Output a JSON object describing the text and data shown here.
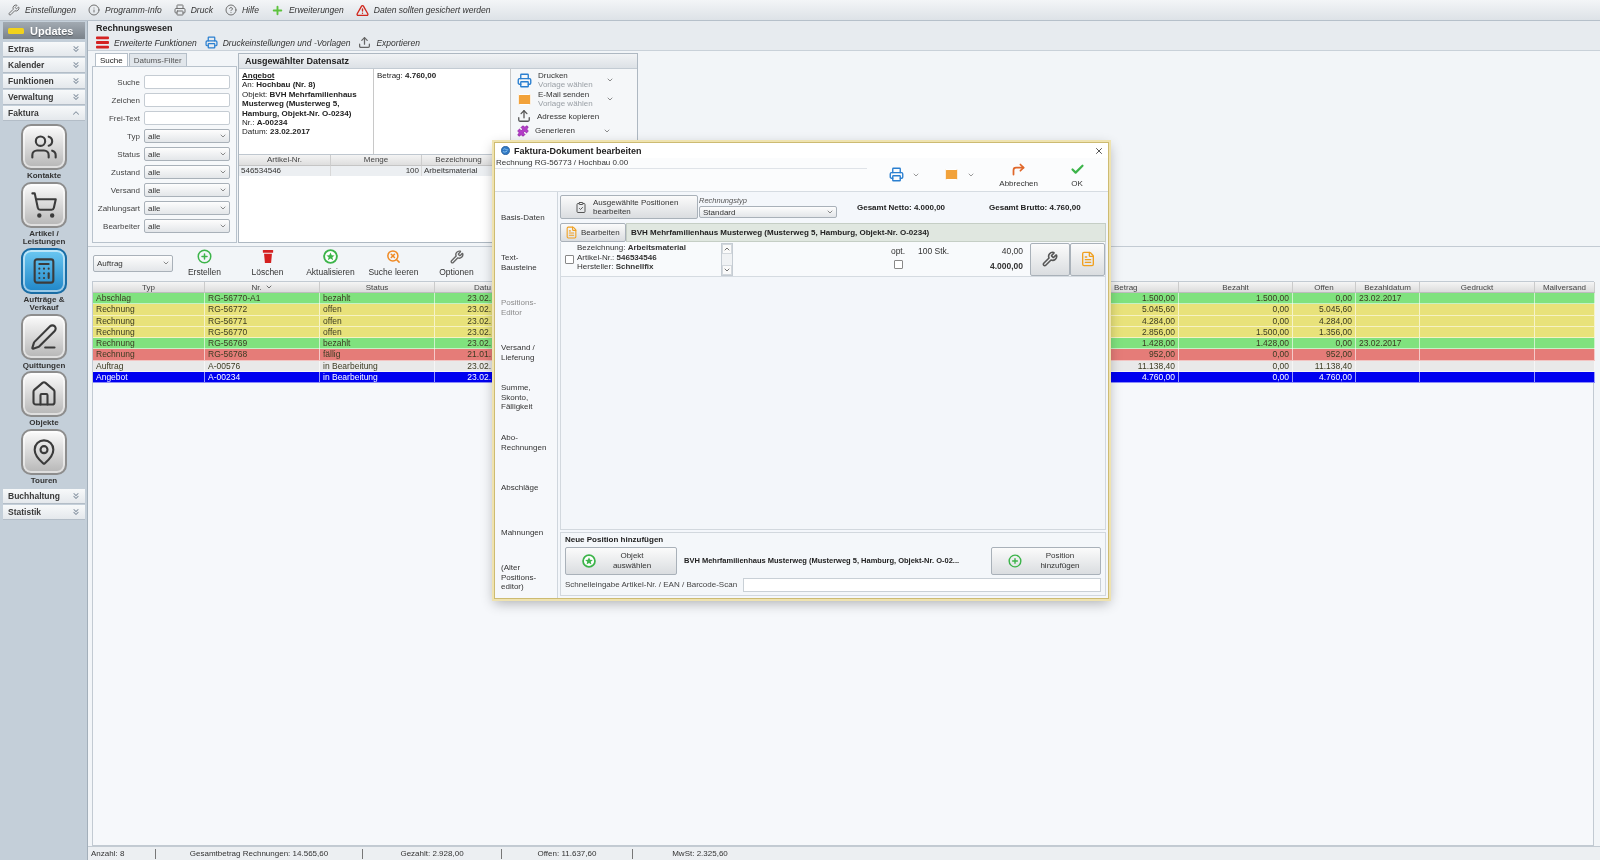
{
  "menu_bar": {
    "items": [
      {
        "kind": "settings",
        "label": "Einstellungen"
      },
      {
        "kind": "info",
        "label": "Programm-Info"
      },
      {
        "kind": "print",
        "label": "Druck"
      },
      {
        "kind": "help",
        "label": "Hilfe"
      },
      {
        "kind": "extensions",
        "label": "Erweiterungen"
      },
      {
        "kind": "warning",
        "label": "Daten sollten gesichert werden"
      }
    ]
  },
  "sidebar": {
    "title": "Updates",
    "sections": [
      {
        "label": "Extras",
        "expanded": false
      },
      {
        "label": "Kalender",
        "expanded": false
      },
      {
        "label": "Funktionen",
        "expanded": false
      },
      {
        "label": "Verwaltung",
        "expanded": false
      },
      {
        "label": "Faktura",
        "expanded": true,
        "items": [
          {
            "kind": "contacts",
            "label": "Kontakte",
            "selected": false
          },
          {
            "kind": "articles",
            "label": "Artikel / Leistungen",
            "selected": false
          },
          {
            "kind": "orders",
            "label": "Aufträge & Verkauf",
            "selected": true
          },
          {
            "kind": "receipts",
            "label": "Quittungen",
            "selected": false
          },
          {
            "kind": "objects",
            "label": "Objekte",
            "selected": false
          },
          {
            "kind": "tours",
            "label": "Touren",
            "selected": false
          }
        ]
      },
      {
        "label": "Buchhaltung",
        "expanded": false
      },
      {
        "label": "Statistik",
        "expanded": false
      }
    ]
  },
  "module": {
    "title": "Rechnungswesen",
    "toolbar": [
      {
        "kind": "functions",
        "label": "Erweiterte Funktionen"
      },
      {
        "kind": "print_settings",
        "label": "Druckeinstellungen und -Vorlagen"
      },
      {
        "kind": "export",
        "label": "Exportieren"
      }
    ]
  },
  "search_panel": {
    "tabs": [
      {
        "label": "Suche",
        "selected": true
      },
      {
        "label": "Datums-Filter",
        "selected": false
      }
    ],
    "fields": [
      {
        "kind": "text",
        "label": "Suche"
      },
      {
        "kind": "text",
        "label": "Zeichen"
      },
      {
        "kind": "text",
        "label": "Frei-Text"
      },
      {
        "kind": "select",
        "label": "Typ",
        "value": "alle"
      },
      {
        "kind": "select",
        "label": "Status",
        "value": "alle"
      },
      {
        "kind": "select",
        "label": "Zustand",
        "value": "alle"
      },
      {
        "kind": "select",
        "label": "Versand",
        "value": "alle"
      },
      {
        "kind": "select",
        "label": "Zahlungsart",
        "value": "alle"
      },
      {
        "kind": "select",
        "label": "Bearbeiter",
        "value": "alle"
      }
    ]
  },
  "record_panel": {
    "title": "Ausgewählter Datensatz",
    "heading": "Angebot",
    "details": [
      "An: **Hochbau (Nr. 8)**",
      "Objekt: **BVH Mehrfamilienhaus Musterweg (Musterweg 5, Hamburg, Objekt-Nr. O-0234)**",
      "Nr.: **A-00234**",
      "Datum: **23.02.2017**"
    ],
    "amount": "Betrag: **4.760,00**",
    "actions": [
      {
        "kind": "print",
        "label": "Drucken",
        "hint": "Vorlage wählen",
        "dropdown": true
      },
      {
        "kind": "email",
        "label": "E-Mail senden",
        "hint": "Vorlage wählen",
        "dropdown": true
      },
      {
        "kind": "copy",
        "label": "Adresse kopieren",
        "dropdown": false
      },
      {
        "kind": "generate",
        "label": "Generieren",
        "dropdown": true
      }
    ],
    "items_table": {
      "columns": [
        "Artikel-Nr.",
        "Menge",
        "Bezeichnung"
      ],
      "rows": [
        [
          "546534546",
          "100",
          "Arbeitsmaterial"
        ]
      ]
    }
  },
  "list_toolbar": {
    "filter": "Auftrag",
    "buttons": [
      {
        "kind": "create",
        "label": "Erstellen"
      },
      {
        "kind": "delete",
        "label": "Löschen"
      },
      {
        "kind": "refresh",
        "label": "Aktualisieren"
      },
      {
        "kind": "clear_search",
        "label": "Suche leeren"
      },
      {
        "kind": "options",
        "label": "Optionen"
      }
    ]
  },
  "table": {
    "columns": [
      {
        "label": "Typ",
        "sorted": false
      },
      {
        "label": "Nr.",
        "sorted": true
      },
      {
        "label": "Status",
        "sorted": false
      },
      {
        "label": "Datu",
        "sorted": false
      },
      {
        "label": "Betrag",
        "sorted": false
      },
      {
        "label": "Bezahlt",
        "sorted": false
      },
      {
        "label": "Offen",
        "sorted": false
      },
      {
        "label": "Bezahldatum",
        "sorted": false
      },
      {
        "label": "Gedruckt",
        "sorted": false
      },
      {
        "label": "Mailversand",
        "sorted": false
      }
    ],
    "rows": [
      {
        "typ": "Abschlag",
        "nr": "RG-56770-A1",
        "status": "bezahlt",
        "column_4": "23.02.",
        "betrag": "1.500,00",
        "bezahlt": "1.500,00",
        "offen": "0,00",
        "bezahldatum": "23.02.2017",
        "color": "#80e27e",
        "selected": false
      },
      {
        "typ": "Rechnung",
        "nr": "RG-56772",
        "status": "offen",
        "column_4": "23.02.",
        "betrag": "5.045,60",
        "bezahlt": "0,00",
        "offen": "5.045,60",
        "color": "#e8e27a",
        "selected": false
      },
      {
        "typ": "Rechnung",
        "nr": "RG-56771",
        "status": "offen",
        "column_4": "23.02.",
        "betrag": "4.284,00",
        "bezahlt": "0,00",
        "offen": "4.284,00",
        "color": "#e8e27a",
        "selected": false
      },
      {
        "typ": "Rechnung",
        "nr": "RG-56770",
        "status": "offen",
        "column_4": "23.02.",
        "betrag": "2.856,00",
        "bezahlt": "1.500,00",
        "offen": "1.356,00",
        "color": "#e8e27a",
        "selected": false
      },
      {
        "typ": "Rechnung",
        "nr": "RG-56769",
        "status": "bezahlt",
        "column_4": "23.02.",
        "betrag": "1.428,00",
        "bezahlt": "1.428,00",
        "offen": "0,00",
        "bezahldatum": "23.02.2017",
        "color": "#80e27e",
        "selected": false
      },
      {
        "typ": "Rechnung",
        "nr": "RG-56768",
        "status": "fällig",
        "column_4": "21.01.",
        "betrag": "952,00",
        "bezahlt": "0,00",
        "offen": "952,00",
        "color": "#e57c78",
        "selected": false
      },
      {
        "typ": "Auftrag",
        "nr": "A-00576",
        "status": "in Bearbeitung",
        "column_4": "23.02.",
        "betrag": "11.138,40",
        "bezahlt": "0,00",
        "offen": "11.138,40",
        "color": "#e9e9e9",
        "selected": false
      },
      {
        "typ": "Angebot",
        "nr": "A-00234",
        "status": "in Bearbeitung",
        "column_4": "23.02.",
        "betrag": "4.760,00",
        "bezahlt": "0,00",
        "offen": "4.760,00",
        "selected": true
      }
    ]
  },
  "status_bar": {
    "items": [
      "Anzahl: 8",
      "Gesamtbetrag Rechnungen: 14.565,60",
      "Gezahlt: 2.928,00",
      "Offen: 11.637,60",
      "MwSt: 2.325,60"
    ]
  },
  "dialog": {
    "title": "Faktura-Dokument bearbeiten",
    "subtitle": "Rechnung RG-56773 / Hochbau 0.00",
    "toolbar": [
      {
        "kind": "print"
      },
      {
        "kind": "email"
      },
      {
        "kind": "cancel",
        "label": "Abbrechen"
      },
      {
        "kind": "ok",
        "label": "OK"
      }
    ],
    "nav": [
      {
        "label": "Basis-Daten",
        "selected": false
      },
      {
        "label": "Text-Bausteine",
        "selected": false
      },
      {
        "label": "Positions-Editor",
        "selected": true
      },
      {
        "label": "Versand / Lieferung",
        "selected": false
      },
      {
        "label": "Summe, Skonto, Fälligkeit",
        "selected": false
      },
      {
        "label": "Abo-Rechnungen",
        "selected": false
      },
      {
        "label": "Abschläge",
        "selected": false
      },
      {
        "label": "Mahnungen",
        "selected": false
      },
      {
        "label": "(Alter Positions-editor)",
        "selected": false
      }
    ],
    "edit_selected_button": "Ausgewählte Positionen bearbeiten",
    "invoice_type": {
      "label": "Rechnungstyp",
      "value": "Standard"
    },
    "totals": [
      "Gesamt Netto: 4.000,00",
      "Gesamt Brutto: 4.760,00"
    ],
    "group": {
      "button": "Bearbeiten",
      "title": "BVH Mehrfamilienhaus Musterweg (Musterweg 5, Hamburg, Objekt-Nr. O-0234)"
    },
    "positions": [
      {
        "checked": false,
        "details": [
          "Bezeichnung: **Arbeitsmaterial**",
          "Artikel-Nr.: **546534546**",
          "Hersteller: **Schnellfix**"
        ],
        "option_label": "opt.",
        "optional": false,
        "quantity": "100 Stk.",
        "unit_price": "40,00",
        "total": "4.000,00"
      }
    ],
    "new_position": {
      "title": "Neue Position hinzufügen",
      "object_button": "Objekt auswählen",
      "object": "BVH Mehrfamilienhaus Musterweg (Musterweg 5, Hamburg, Objekt-Nr. O-02...",
      "add_button": "Position hinzufügen",
      "quick_entry_label": "Schnelleingabe Artikel-Nr. / EAN / Barcode-Scan"
    }
  }
}
